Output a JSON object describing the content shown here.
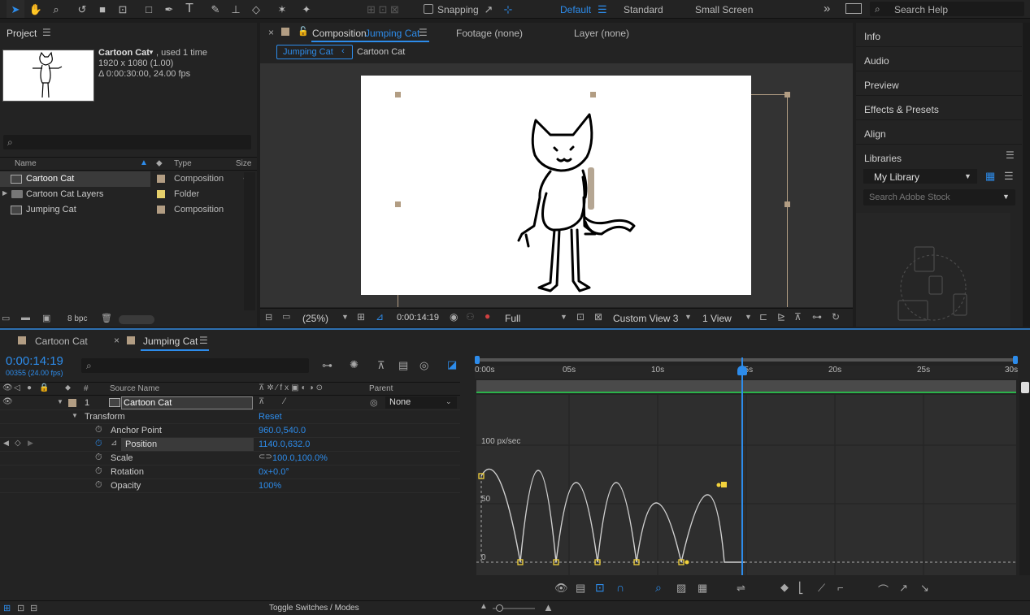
{
  "toolbar": {
    "snapping_label": "Snapping",
    "workspaces": [
      "Default",
      "Standard",
      "Small Screen"
    ],
    "search_placeholder": "Search Help"
  },
  "project": {
    "title": "Project",
    "item_name": "Cartoon Cat",
    "item_used": ", used 1 time",
    "item_res": "1920 x 1080 (1.00)",
    "item_dur": "Δ 0:00:30:00, 24.00 fps",
    "col_name": "Name",
    "col_type": "Type",
    "col_size": "Size",
    "rows": [
      {
        "name": "Cartoon Cat",
        "type": "Composition",
        "color": "#b29d83"
      },
      {
        "name": "Cartoon Cat Layers",
        "type": "Folder",
        "color": "#e5cf6a"
      },
      {
        "name": "Jumping Cat",
        "type": "Composition",
        "color": "#b29d83"
      }
    ],
    "bpc": "8 bpc"
  },
  "comp": {
    "tab_prefix": "Composition",
    "tab_name": "Jumping Cat",
    "footage_tab": "Footage (none)",
    "layer_tab": "Layer (none)",
    "nav_active": "Jumping Cat",
    "nav_other": "Cartoon Cat",
    "zoom": "(25%)",
    "timecode": "0:00:14:19",
    "resolution": "Full",
    "view": "Custom View 3",
    "views": "1 View"
  },
  "right": {
    "panels": [
      "Info",
      "Audio",
      "Preview",
      "Effects & Presets",
      "Align",
      "Libraries"
    ],
    "library": "My Library",
    "stock_placeholder": "Search Adobe Stock"
  },
  "timeline": {
    "tabs": [
      "Cartoon Cat",
      "Jumping Cat"
    ],
    "timecode": "0:00:14:19",
    "frame_info": "00355 (24.00 fps)",
    "col_num": "#",
    "col_source": "Source Name",
    "col_parent": "Parent",
    "layer_num": "1",
    "layer_name": "Cartoon Cat",
    "parent_value": "None",
    "transform_label": "Transform",
    "reset_label": "Reset",
    "props": [
      {
        "name": "Anchor Point",
        "value": "960.0,540.0"
      },
      {
        "name": "Position",
        "value": "1140.0,632.0"
      },
      {
        "name": "Scale",
        "value": "100.0,100.0%"
      },
      {
        "name": "Rotation",
        "value": "0x+0.0°"
      },
      {
        "name": "Opacity",
        "value": "100%"
      }
    ],
    "ruler_labels": [
      "0:00s",
      "05s",
      "10s",
      "15s",
      "20s",
      "25s",
      "30s"
    ],
    "graph_labels": [
      "100 px/sec",
      "50",
      "0"
    ],
    "toggle_label": "Toggle Switches / Modes"
  }
}
